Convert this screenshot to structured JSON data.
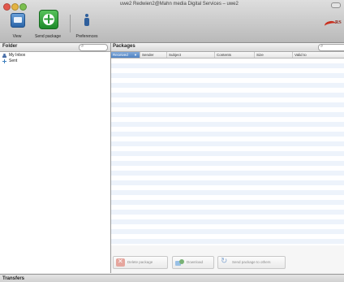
{
  "window": {
    "title": "uwe2 Redwien2@Mahn media Digital Services – uwe2"
  },
  "toolbar": {
    "view_label": "View",
    "send_package_label": "Send package",
    "preferences_label": "Preferences",
    "brand_text": "RS"
  },
  "folder_pane": {
    "header": "Folder",
    "items": [
      {
        "label": "My Inbox",
        "icon": "person-icon"
      },
      {
        "label": "Sent",
        "icon": "plus-icon"
      }
    ]
  },
  "packages_pane": {
    "header": "Packages",
    "columns": [
      {
        "label": "Received",
        "sorted": true
      },
      {
        "label": "Sender"
      },
      {
        "label": "Subject"
      },
      {
        "label": "Contents"
      },
      {
        "label": "Size"
      },
      {
        "label": "Valid to"
      }
    ],
    "actions": {
      "delete_label": "Delete package",
      "download_label": "Download",
      "forward_label": "Send package to others"
    }
  },
  "transfers": {
    "header": "Transfers"
  }
}
